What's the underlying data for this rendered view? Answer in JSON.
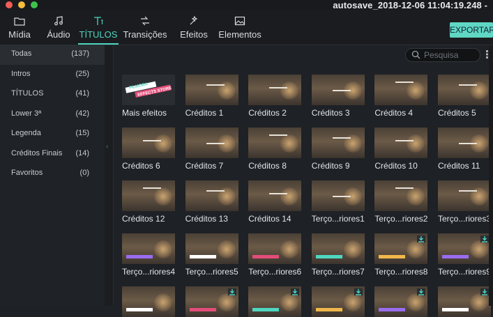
{
  "window": {
    "title": "autosave_2018-12-06 11:04:19.248 -"
  },
  "toolbar": {
    "tabs": [
      {
        "label": "Mídia",
        "icon": "folder-icon",
        "active": false
      },
      {
        "label": "Áudio",
        "icon": "music-note-icon",
        "active": false
      },
      {
        "label": "TÍTULOS",
        "icon": "text-title-icon",
        "active": true
      },
      {
        "label": "Transições",
        "icon": "transition-icon",
        "active": false
      },
      {
        "label": "Efeitos",
        "icon": "effects-icon",
        "active": false
      },
      {
        "label": "Elementos",
        "icon": "image-icon",
        "active": false
      }
    ],
    "export_label": "EXPORTAR"
  },
  "sidebar": {
    "items": [
      {
        "name": "Todas",
        "count": "(137)",
        "selected": true
      },
      {
        "name": "Intros",
        "count": "(25)",
        "selected": false
      },
      {
        "name": "TÍTULOS",
        "count": "(41)",
        "selected": false
      },
      {
        "name": "Lower 3ª",
        "count": "(42)",
        "selected": false
      },
      {
        "name": "Legenda",
        "count": "(15)",
        "selected": false
      },
      {
        "name": "Créditos Finais",
        "count": "(14)",
        "selected": false
      },
      {
        "name": "Favoritos",
        "count": "(0)",
        "selected": false
      }
    ]
  },
  "search": {
    "placeholder": "Pesquisa"
  },
  "grid": {
    "items": [
      {
        "label": "Mais efeitos",
        "kind": "store"
      },
      {
        "label": "Créditos 1"
      },
      {
        "label": "Créditos 2"
      },
      {
        "label": "Créditos 3"
      },
      {
        "label": "Créditos 4"
      },
      {
        "label": "Créditos 5"
      },
      {
        "label": "Créditos 6"
      },
      {
        "label": "Créditos 7"
      },
      {
        "label": "Créditos 8"
      },
      {
        "label": "Créditos 9"
      },
      {
        "label": "Créditos 10"
      },
      {
        "label": "Créditos 11"
      },
      {
        "label": "Créditos 12"
      },
      {
        "label": "Créditos 13"
      },
      {
        "label": "Créditos 14"
      },
      {
        "label": "Terço...riores1"
      },
      {
        "label": "Terço...riores2"
      },
      {
        "label": "Terço...riores3"
      },
      {
        "label": "Terço...riores4"
      },
      {
        "label": "Terço...riores5"
      },
      {
        "label": "Terço...riores6"
      },
      {
        "label": "Terço...riores7"
      },
      {
        "label": "Terço...riores8",
        "download": true
      },
      {
        "label": "Terço...riores9",
        "download": true
      },
      {
        "label": "",
        "download": false
      },
      {
        "label": "",
        "download": true
      },
      {
        "label": "",
        "download": true
      },
      {
        "label": "",
        "download": true
      },
      {
        "label": "",
        "download": true
      },
      {
        "label": "",
        "download": true
      }
    ]
  },
  "store_badge": {
    "line1": "FILMORA",
    "line2": "EFFECTS STORE"
  },
  "colors": {
    "accent": "#4fd6c1",
    "export_bg": "#5fd7c3"
  }
}
